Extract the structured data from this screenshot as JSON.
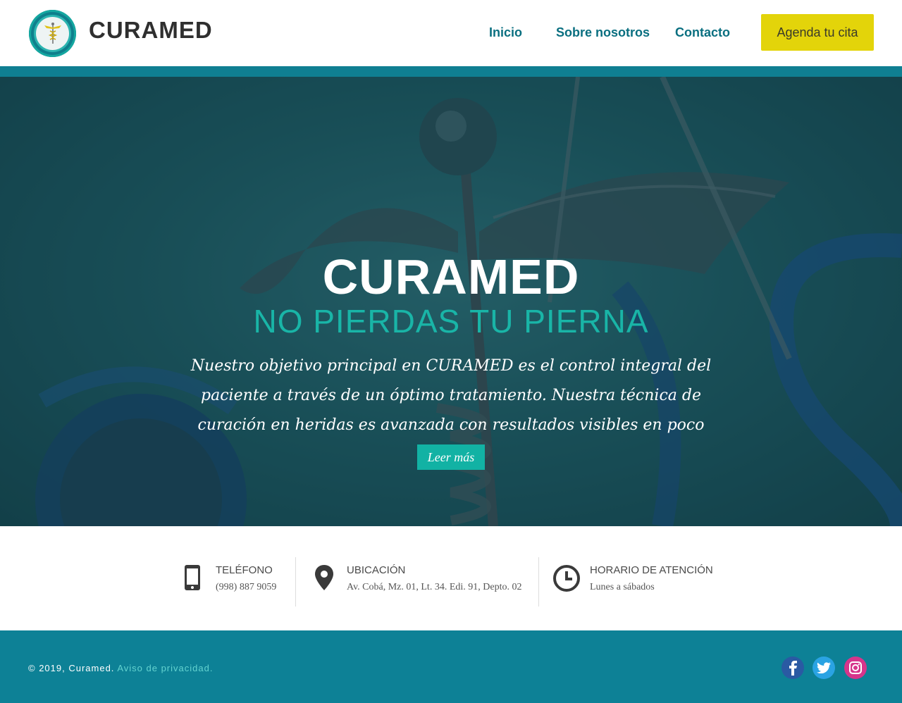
{
  "header": {
    "brand": "CURAMED",
    "nav": [
      "Inicio",
      "Sobre nosotros",
      "Contacto"
    ],
    "cta_label": "Agenda tu cita"
  },
  "hero": {
    "title": "CURAMED",
    "subtitle": "NO PIERDAS TU PIERNA",
    "text": "Nuestro objetivo principal en CURAMED es el control integral del paciente a través de un óptimo tratamiento. Nuestra técnica de curación en heridas es avanzada con resultados visibles en poco tiempo.",
    "button_label": "Leer más"
  },
  "info": [
    {
      "icon": "phone-icon",
      "label": "TELÉFONO",
      "value": "(998) 887 9059"
    },
    {
      "icon": "location-pin-icon",
      "label": "UBICACIÓN",
      "value": "Av. Cobá, Mz. 01, Lt. 34. Edi. 91, Depto. 02"
    },
    {
      "icon": "clock-icon",
      "label": "HORARIO DE ATENCIÓN",
      "value": "Lunes a sábados"
    }
  ],
  "footer": {
    "copyright": "© 2019, Curamed.",
    "privacy": "Aviso de privacidad.",
    "social": [
      "facebook-icon",
      "twitter-icon",
      "instagram-icon"
    ]
  },
  "colors": {
    "teal_dark": "#0d8196",
    "teal_accent": "#12b2a4",
    "nav_text": "#0a6f80",
    "cta_yellow": "#e3d40a"
  }
}
